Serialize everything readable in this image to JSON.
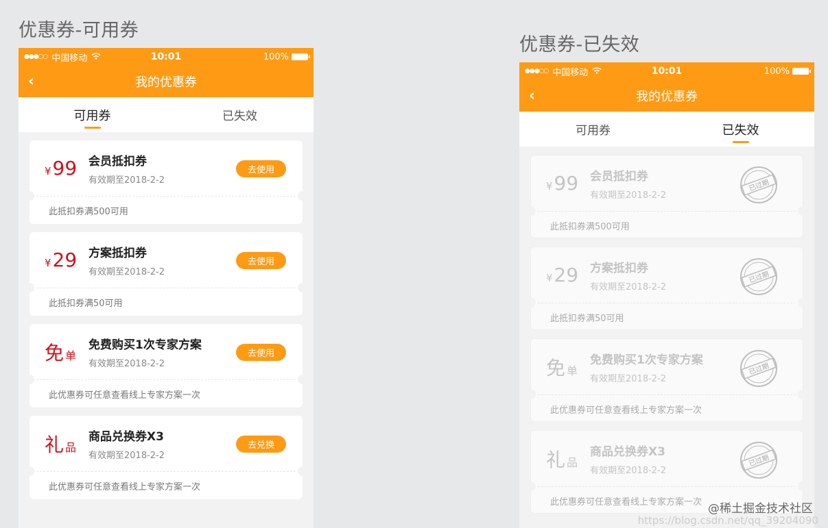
{
  "left_panel": {
    "section_title": "优惠券-可用券",
    "status": {
      "carrier": "中国移动",
      "time": "10:01",
      "battery": "100%"
    },
    "nav_title": "我的优惠券",
    "tabs": [
      {
        "label": "可用券",
        "active": true
      },
      {
        "label": "已失效",
        "active": false
      }
    ],
    "coupons": [
      {
        "currency": "¥",
        "amount": "99",
        "name": "会员抵扣券",
        "expiry": "有效期至2018-2-2",
        "action": "去使用",
        "desc": "此抵扣券满500可用"
      },
      {
        "currency": "¥",
        "amount": "29",
        "name": "方案抵扣券",
        "expiry": "有效期至2018-2-2",
        "action": "去使用",
        "desc": "此抵扣券满50可用"
      },
      {
        "big_char": "免",
        "small_char": "单",
        "name": "免费购买1次专家方案",
        "expiry": "有效期至2018-2-2",
        "action": "去使用",
        "desc": "此优惠券可任意查看线上专家方案一次"
      },
      {
        "big_char": "礼",
        "small_char": "品",
        "name": "商品兑换券X3",
        "expiry": "有效期至2018-2-2",
        "action": "去兑换",
        "desc": "此优惠券可任意查看线上专家方案一次"
      }
    ]
  },
  "right_panel": {
    "section_title": "优惠券-已失效",
    "status": {
      "carrier": "中国移动",
      "time": "10:01",
      "battery": "100%"
    },
    "nav_title": "我的优惠券",
    "tabs": [
      {
        "label": "可用券",
        "active": false
      },
      {
        "label": "已失效",
        "active": true
      }
    ],
    "coupons": [
      {
        "currency": "¥",
        "amount": "99",
        "name": "会员抵扣券",
        "expiry": "有效期至2018-2-2",
        "stamp": "已过期",
        "desc": "此抵扣券满500可用"
      },
      {
        "currency": "¥",
        "amount": "29",
        "name": "方案抵扣券",
        "expiry": "有效期至2018-2-2",
        "stamp": "已过期",
        "desc": "此抵扣券满50可用"
      },
      {
        "big_char": "免",
        "small_char": "单",
        "name": "免费购买1次专家方案",
        "expiry": "有效期至2018-2-2",
        "stamp": "已过期",
        "desc": "此优惠券可任意查看线上专家方案一次"
      },
      {
        "big_char": "礼",
        "small_char": "品",
        "name": "商品兑换券X3",
        "expiry": "有效期至2018-2-2",
        "stamp": "已过期",
        "desc": "此优惠券可任意查看线上专家方案一次"
      }
    ]
  },
  "colors": {
    "accent": "#ff9a14",
    "price_red": "#d0101b",
    "expired_gray": "#c4c4c4"
  },
  "watermark": "@稀土掘金技术社区",
  "watermark_url": "https://blog.csdn.net/qq_39204090"
}
